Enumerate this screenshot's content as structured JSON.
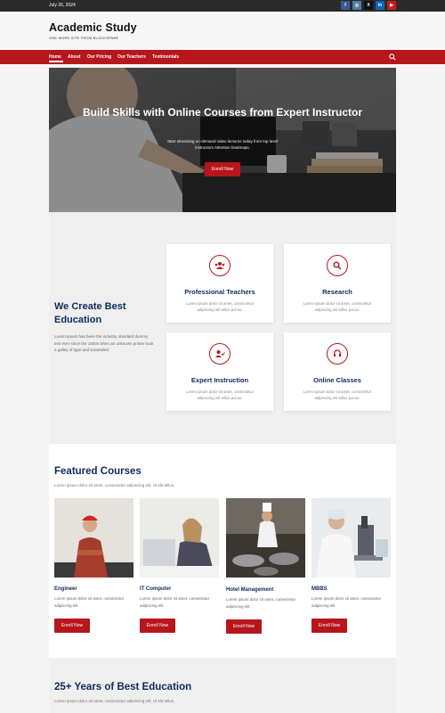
{
  "topbar": {
    "date": "July 26, 2024",
    "social_icons": [
      {
        "name": "facebook-icon",
        "glyph": "f",
        "color": "#3b5998"
      },
      {
        "name": "instagram-icon",
        "glyph": "◎",
        "color": "#517fa4"
      },
      {
        "name": "x-icon",
        "glyph": "X",
        "color": "#111111"
      },
      {
        "name": "linkedin-icon",
        "glyph": "in",
        "color": "#0a66c2"
      },
      {
        "name": "youtube-icon",
        "glyph": "▶",
        "color": "#cc181e"
      }
    ]
  },
  "header": {
    "title": "Academic Study",
    "tagline": "ONE MORE SITE FROM BLOCKSPARE"
  },
  "nav": {
    "items": [
      "Home",
      "About",
      "Our Pricing",
      "Our Teachers",
      "Testimonials"
    ],
    "search_icon": "search-icon"
  },
  "hero": {
    "title": "Build Skills with Online Courses from Expert Instructor",
    "subtitle": "Start streaming on-demand video lectures today from top level instructors Attention heatmaps.",
    "button": "Enroll Now"
  },
  "features": {
    "title": "We Create Best Education",
    "description": "Lorem Ipsum has been the industry standard dummy text ever since the 1500s when an unknown printer took a galley of type and scrambled",
    "cards": [
      {
        "title": "Professional Teachers",
        "text": "Lorem ipsum dolor sit amet, consectetur adipiscing elit tellus pocus.",
        "icon": "users-icon"
      },
      {
        "title": "Research",
        "text": "Lorem ipsum dolor sit amet, consectetur adipiscing elit tellus pocus.",
        "icon": "search-icon"
      },
      {
        "title": "Expert Instruction",
        "text": "Lorem ipsum dolor sit amet, consectetur adipiscing elit tellus pocus.",
        "icon": "user-check-icon"
      },
      {
        "title": "Online Classes",
        "text": "Lorem ipsum dolor sit amet, consectetur adipiscing elit tellus pocus.",
        "icon": "headset-icon"
      }
    ]
  },
  "courses": {
    "title": "Featured Courses",
    "subtitle": "Lorem ipsum dolor sit amet, consectetur adipiscing elit. Ut elit tellus.",
    "items": [
      {
        "name": "Engineer",
        "text": "Lorem ipsum dolor sit amet, consectetur adipiscing elit.",
        "button": "Enroll Now"
      },
      {
        "name": "IT Computer",
        "text": "Lorem ipsum dolor sit amet, consectetur adipiscing elit.",
        "button": "Enroll Now"
      },
      {
        "name": "Hotel Management",
        "text": "Lorem ipsum dolor sit amet, consectetur adipiscing elit.",
        "button": "Enroll Now"
      },
      {
        "name": "MBBS",
        "text": "Lorem ipsum dolor sit amet, consectetur adipiscing elit.",
        "button": "Enroll Now"
      }
    ]
  },
  "years": {
    "title": "25+ Years of Best Education",
    "subtitle": "Lorem ipsum dolor sit amet, consectetur adipiscing elit. Ut elit tellus."
  },
  "colors": {
    "accent": "#b7161c",
    "heading": "#102a5a",
    "topbar": "#2a2a2a"
  }
}
